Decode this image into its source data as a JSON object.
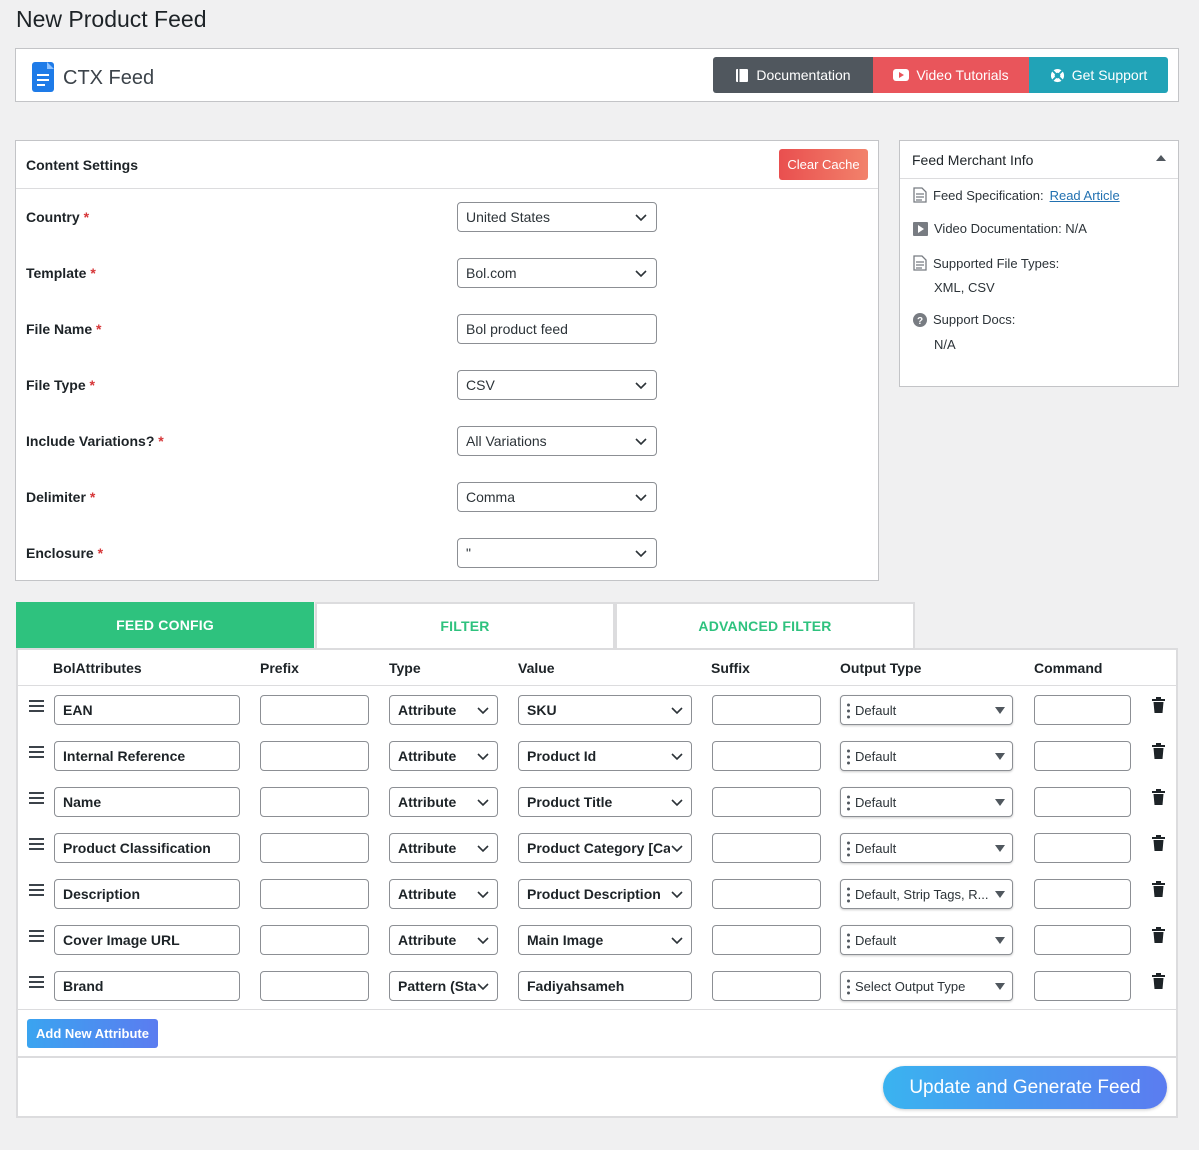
{
  "page_title": "New Product Feed",
  "header": {
    "brand": "CTX Feed",
    "buttons": {
      "documentation": "Documentation",
      "video_tutorials": "Video Tutorials",
      "get_support": "Get Support"
    }
  },
  "content_settings": {
    "title": "Content Settings",
    "clear_cache": "Clear Cache",
    "required_mark": "*",
    "fields": [
      {
        "label": "Country",
        "value": "United States",
        "type": "select"
      },
      {
        "label": "Template",
        "value": "Bol.com",
        "type": "select"
      },
      {
        "label": "File Name",
        "value": "Bol product feed",
        "type": "input"
      },
      {
        "label": "File Type",
        "value": "CSV",
        "type": "select"
      },
      {
        "label": "Include Variations?",
        "value": "All Variations",
        "type": "select"
      },
      {
        "label": "Delimiter",
        "value": "Comma",
        "type": "select"
      },
      {
        "label": "Enclosure",
        "value": "\"",
        "type": "select"
      }
    ]
  },
  "merchant_info": {
    "title": "Feed Merchant Info",
    "spec_label": "Feed Specification:",
    "spec_link": "Read Article",
    "video_label": "Video Documentation: N/A",
    "file_types_label": "Supported File Types:",
    "file_types_value": "XML, CSV",
    "docs_label": "Support Docs:",
    "docs_value": "N/A"
  },
  "tabs": {
    "feed_config": "FEED CONFIG",
    "filter": "FILTER",
    "advanced_filter": "ADVANCED FILTER"
  },
  "table": {
    "headers": {
      "attributes": "BolAttributes",
      "prefix": "Prefix",
      "type": "Type",
      "value": "Value",
      "suffix": "Suffix",
      "output_type": "Output Type",
      "command": "Command"
    },
    "rows": [
      {
        "attribute": "EAN",
        "prefix": "",
        "type": "Attribute",
        "value": "SKU",
        "value_is_select": true,
        "suffix": "",
        "output_type": "Default",
        "command": ""
      },
      {
        "attribute": "Internal Reference",
        "prefix": "",
        "type": "Attribute",
        "value": "Product Id",
        "value_is_select": true,
        "suffix": "",
        "output_type": "Default",
        "command": ""
      },
      {
        "attribute": "Name",
        "prefix": "",
        "type": "Attribute",
        "value": "Product Title",
        "value_is_select": true,
        "suffix": "",
        "output_type": "Default",
        "command": ""
      },
      {
        "attribute": "Product Classification",
        "prefix": "",
        "type": "Attribute",
        "value": "Product Category [Ca",
        "value_is_select": true,
        "suffix": "",
        "output_type": "Default",
        "command": ""
      },
      {
        "attribute": "Description",
        "prefix": "",
        "type": "Attribute",
        "value": "Product Description",
        "value_is_select": true,
        "suffix": "",
        "output_type": "Default, Strip Tags, R...",
        "command": ""
      },
      {
        "attribute": "Cover Image URL",
        "prefix": "",
        "type": "Attribute",
        "value": "Main Image",
        "value_is_select": true,
        "suffix": "",
        "output_type": "Default",
        "command": ""
      },
      {
        "attribute": "Brand",
        "prefix": "",
        "type": "Pattern (Sta",
        "value": "Fadiyahsameh",
        "value_is_select": false,
        "suffix": "",
        "output_type": "Select Output Type",
        "command": ""
      }
    ],
    "add_button": "Add New Attribute"
  },
  "footer": {
    "generate_button": "Update and Generate Feed"
  },
  "colors": {
    "accent_green": "#2ec27e",
    "doc_button": "#50575e",
    "video_button": "#e9555b",
    "support_button": "#21a3b7",
    "link": "#2271b1"
  }
}
